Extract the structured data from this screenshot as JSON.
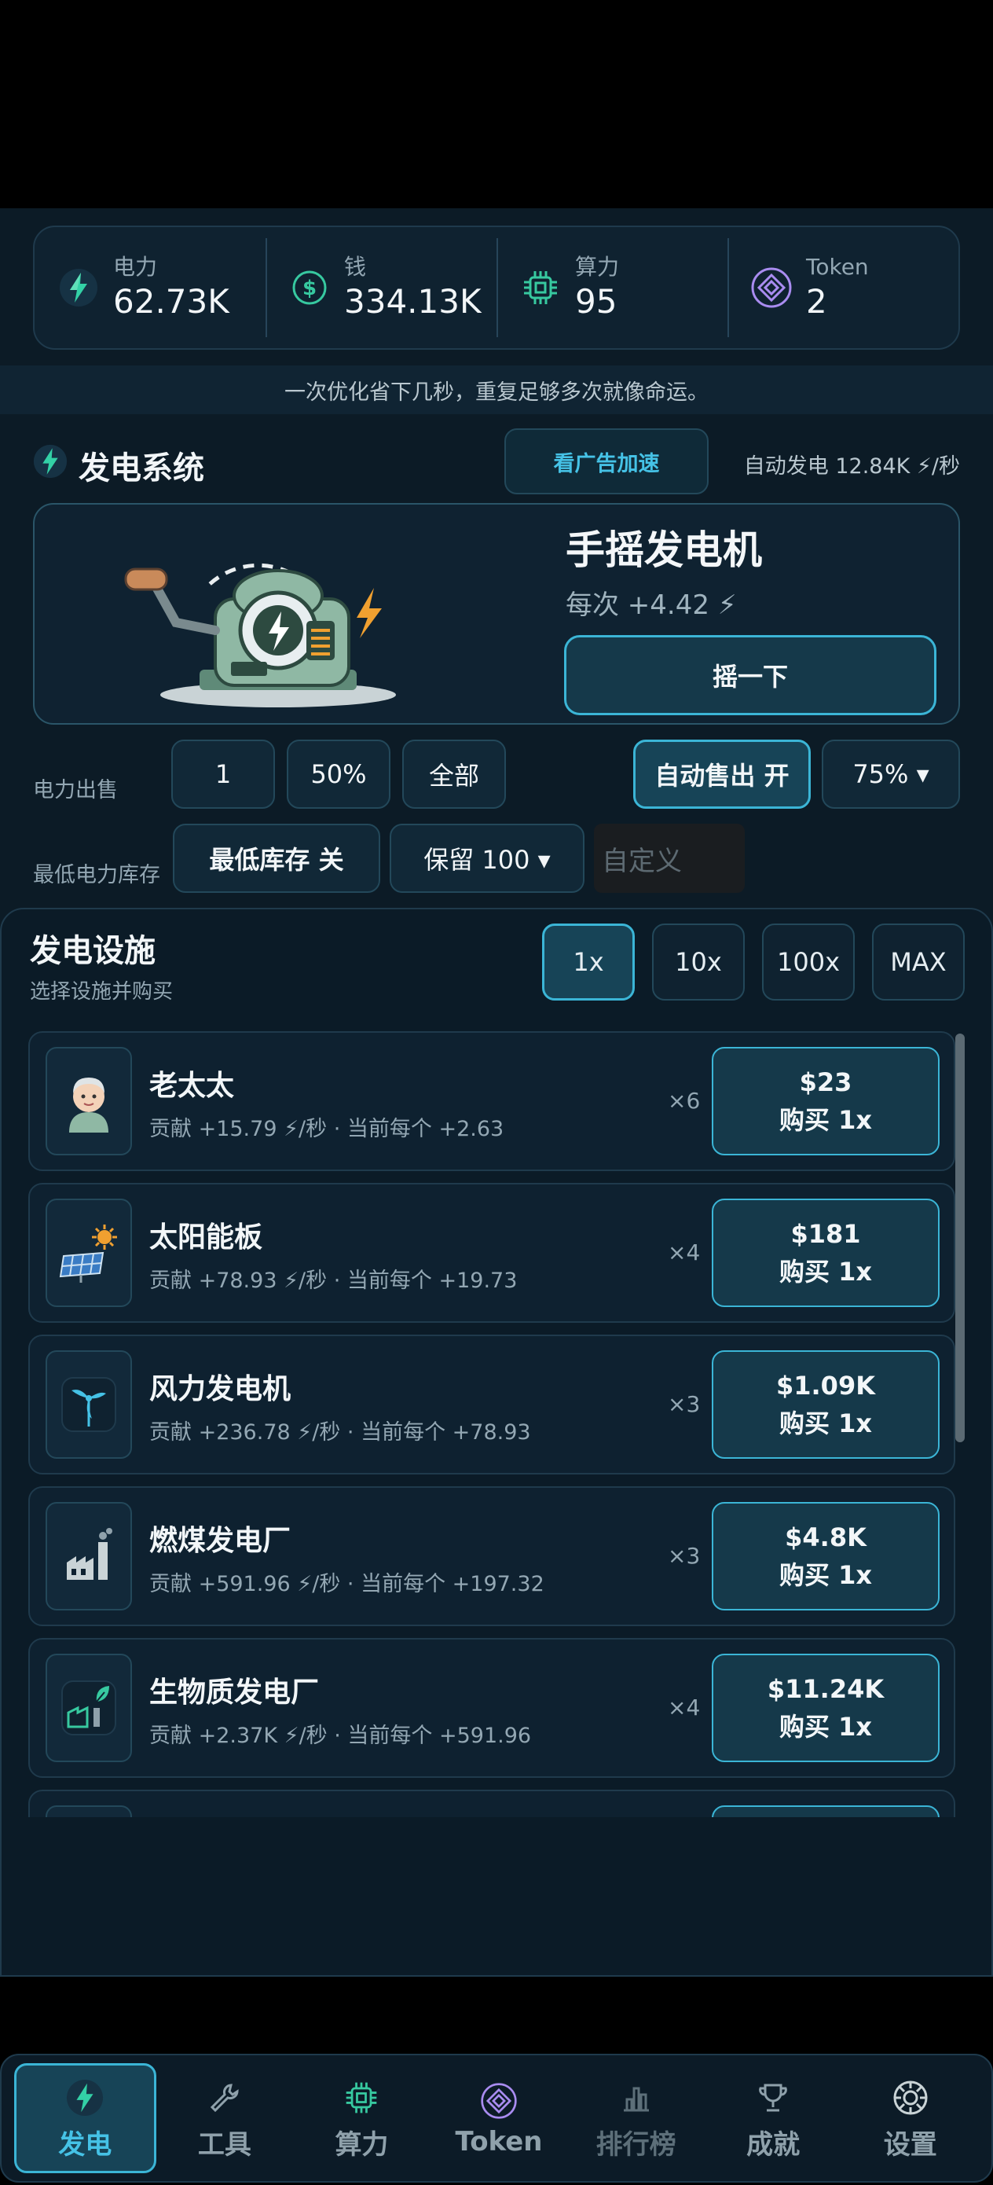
{
  "stats": [
    {
      "icon": "bolt-icon",
      "label": "电力",
      "value": "62.73K"
    },
    {
      "icon": "dollar-coin-icon",
      "label": "钱",
      "value": "334.13K"
    },
    {
      "icon": "cpu-chip-icon",
      "label": "算力",
      "value": "95"
    },
    {
      "icon": "token-diamond-icon",
      "label": "Token",
      "value": "2"
    }
  ],
  "tip": "一次优化省下几秒，重复足够多次就像命运。",
  "generation": {
    "title": "发电系统",
    "ad_button": "看广告加速",
    "auto_gen": "自动发电  12.84K ⚡/秒",
    "generator_name": "手摇发电机",
    "per_crank": "每次 +4.42 ⚡",
    "crank_button": "摇一下"
  },
  "sell": {
    "label": "电力出售",
    "qty": "1",
    "half": "50%",
    "all": "全部",
    "auto_sell": "自动售出  开",
    "auto_percent": "75%  ▾"
  },
  "reserve": {
    "label": "最低电力库存",
    "toggle": "最低库存  关",
    "keep": "保留 100  ▾",
    "custom_placeholder": "自定义"
  },
  "facilities": {
    "title": "发电设施",
    "subtitle": "选择设施并购买",
    "multipliers": [
      "1x",
      "10x",
      "100x",
      "MAX"
    ],
    "items": [
      {
        "icon": "old-lady-icon",
        "name": "老太太",
        "desc": "贡献 +15.79 ⚡/秒 · 当前每个 +2.63",
        "count": "×6",
        "price": "$23",
        "buy": "购买 1x"
      },
      {
        "icon": "solar-panel-icon",
        "name": "太阳能板",
        "desc": "贡献 +78.93 ⚡/秒 · 当前每个 +19.73",
        "count": "×4",
        "price": "$181",
        "buy": "购买 1x"
      },
      {
        "icon": "wind-turbine-icon",
        "name": "风力发电机",
        "desc": "贡献 +236.78 ⚡/秒 · 当前每个 +78.93",
        "count": "×3",
        "price": "$1.09K",
        "buy": "购买 1x"
      },
      {
        "icon": "coal-plant-icon",
        "name": "燃煤发电厂",
        "desc": "贡献 +591.96 ⚡/秒 · 当前每个 +197.32",
        "count": "×3",
        "price": "$4.8K",
        "buy": "购买 1x"
      },
      {
        "icon": "biomass-plant-icon",
        "name": "生物质发电厂",
        "desc": "贡献 +2.37K ⚡/秒 · 当前每个 +591.96",
        "count": "×4",
        "price": "$11.24K",
        "buy": "购买 1x"
      }
    ]
  },
  "nav": [
    {
      "icon": "bolt-icon",
      "label": "发电"
    },
    {
      "icon": "wrench-icon",
      "label": "工具"
    },
    {
      "icon": "cpu-chip-icon",
      "label": "算力"
    },
    {
      "icon": "token-diamond-icon",
      "label": "Token"
    },
    {
      "icon": "bar-chart-icon",
      "label": "排行榜"
    },
    {
      "icon": "trophy-icon",
      "label": "成就"
    },
    {
      "icon": "gear-icon",
      "label": "设置"
    }
  ],
  "colors": {
    "accent": "#3bb5d6",
    "bolt": "#f0a030",
    "background": "#0c1b26"
  }
}
